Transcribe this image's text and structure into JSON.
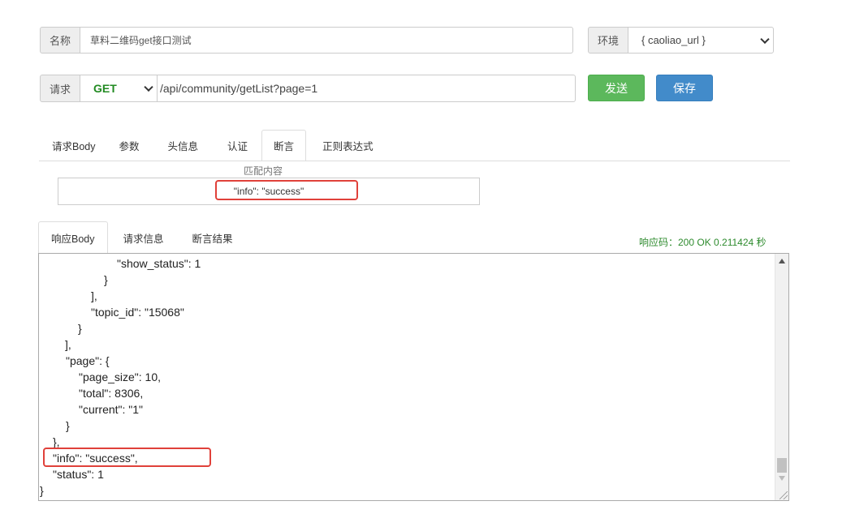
{
  "form": {
    "name_label": "名称",
    "name_value": "草料二维码get接口测试",
    "env_label": "环境",
    "env_value": "{ caoliao_url }",
    "method_label": "请求",
    "method_value": "GET",
    "url_value": "/api/community/getList?page=1",
    "send_label": "发送",
    "save_label": "保存"
  },
  "request_tabs": [
    {
      "label": "请求Body",
      "active": false
    },
    {
      "label": "参数",
      "active": false
    },
    {
      "label": "头信息",
      "active": false
    },
    {
      "label": "认证",
      "active": false
    },
    {
      "label": "断言",
      "active": true
    },
    {
      "label": "正则表达式",
      "active": false
    }
  ],
  "assertion": {
    "match_label": "匹配内容",
    "match_value": "\"info\": \"success\""
  },
  "response_tabs": [
    {
      "label": "响应Body",
      "active": true
    },
    {
      "label": "请求信息",
      "active": false
    },
    {
      "label": "断言结果",
      "active": false
    }
  ],
  "response_status": "响应码：200 OK   0.211424 秒",
  "response_lines": [
    "\"show_status\": 1",
    "}",
    "],",
    "\"topic_id\": \"15068\"",
    "}",
    "],",
    "\"page\": {",
    "\"page_size\": 10,",
    "\"total\": 8306,",
    "\"current\": \"1\"",
    "}",
    "},",
    "\"info\": \"success\",",
    "\"status\": 1",
    "}"
  ],
  "colors": {
    "send_button": "#5cb85c",
    "save_button": "#428bca",
    "method_text": "#228b22",
    "status_text": "#2e8b2e",
    "highlight_box": "#e0413a"
  }
}
